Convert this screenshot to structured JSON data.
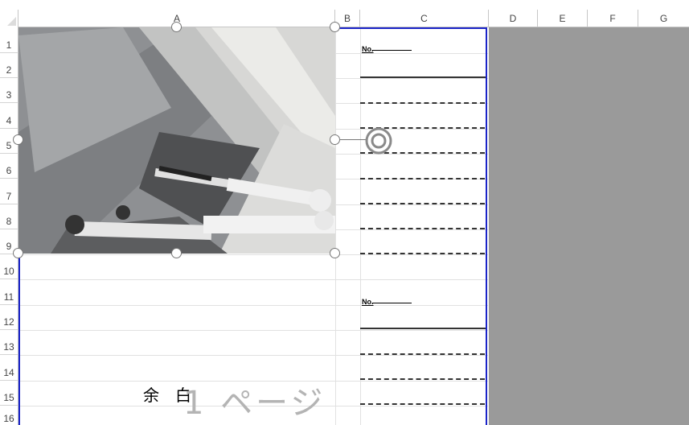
{
  "columns": [
    {
      "key": "corner",
      "label": ""
    },
    {
      "key": "A",
      "label": "A"
    },
    {
      "key": "B",
      "label": "B"
    },
    {
      "key": "C",
      "label": "C"
    },
    {
      "key": "D",
      "label": "D"
    },
    {
      "key": "E",
      "label": "E"
    },
    {
      "key": "F",
      "label": "F"
    },
    {
      "key": "G",
      "label": "G"
    }
  ],
  "rows": [
    "1",
    "2",
    "3",
    "4",
    "5",
    "6",
    "7",
    "8",
    "9",
    "10",
    "11",
    "12",
    "13",
    "14",
    "15"
  ],
  "form_blocks": [
    {
      "no_label": "No."
    },
    {
      "no_label": "No."
    }
  ],
  "page_watermark": {
    "margin_text": "余　白",
    "page_text": "1 ページ"
  },
  "icons": {
    "rotate_handle": "rotate-icon",
    "resize_handle": "resize-handle-icon"
  },
  "colors": {
    "page_break_line": "#1b24c8",
    "outside_print_area": "#9a9a9a",
    "watermark": "#b4b4b4"
  }
}
